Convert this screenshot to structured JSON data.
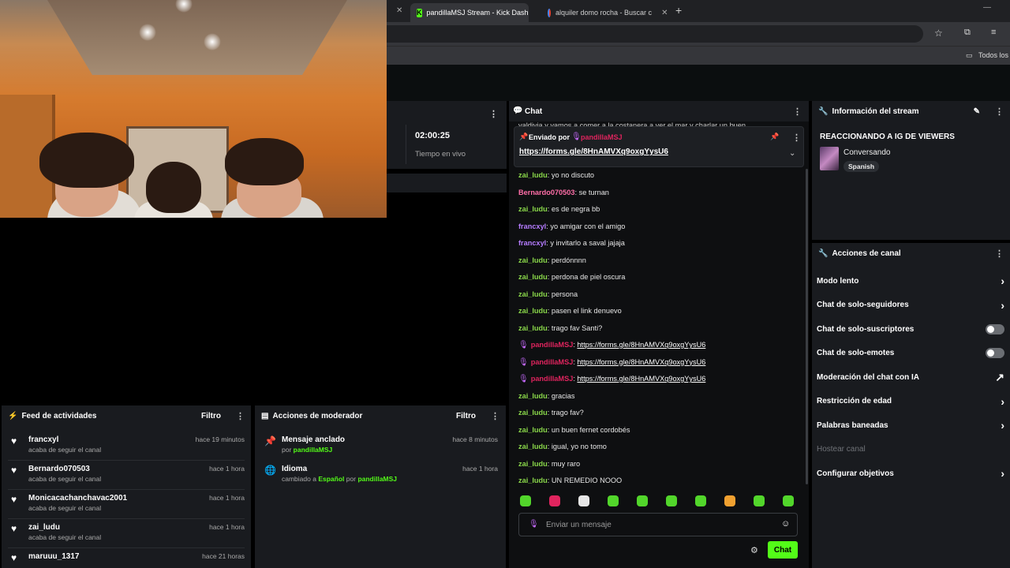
{
  "browser": {
    "tabs": [
      {
        "label": "pandillaMSJ Stream - Kick Dash",
        "active": true
      },
      {
        "label": "alquiler domo rocha - Buscar c",
        "active": false
      }
    ],
    "new_tab": "+",
    "bookmarks_label": "Todos los m"
  },
  "stats": {
    "duration": "02:00:25",
    "duration_label": "Tiempo en vivo"
  },
  "chat": {
    "title": "Chat",
    "cut_message": "valdivia y vamos a comer a la costanera a ver el mar y charlar un buen",
    "pinned": {
      "sent_by_label": "Enviado por",
      "sender": "pandillaMSJ",
      "link": "https://forms.gle/8HnAMVXq9oxgYysU6"
    },
    "messages": [
      {
        "user": "zai_ludu",
        "text": "yo no discuto",
        "color": "#8ad84a"
      },
      {
        "user": "Bernardo070503",
        "text": "se turnan",
        "color": "#ff6ea8"
      },
      {
        "user": "zai_ludu",
        "text": "es de negra bb",
        "color": "#8ad84a"
      },
      {
        "user": "francxyl",
        "text": "yo amigar con el amigo",
        "color": "#b57cff"
      },
      {
        "user": "francxyl",
        "text": "y invitarlo a saval jajaja",
        "color": "#b57cff"
      },
      {
        "user": "zai_ludu",
        "text": "perdónnnn",
        "color": "#8ad84a"
      },
      {
        "user": "zai_ludu",
        "text": "perdona de piel oscura",
        "color": "#8ad84a"
      },
      {
        "user": "zai_ludu",
        "text": "persona",
        "color": "#8ad84a"
      },
      {
        "user": "zai_ludu",
        "text": "pasen el link denuevo",
        "color": "#8ad84a"
      },
      {
        "user": "zai_ludu",
        "text": "trago fav Santi?",
        "color": "#8ad84a"
      },
      {
        "user": "pandillaMSJ",
        "text": "https://forms.gle/8HnAMVXq9oxgYysU6",
        "color": "#e0245e",
        "link": true
      },
      {
        "user": "pandillaMSJ",
        "text": "https://forms.gle/8HnAMVXq9oxgYysU6",
        "color": "#e0245e",
        "link": true
      },
      {
        "user": "pandillaMSJ",
        "text": "https://forms.gle/8HnAMVXq9oxgYysU6",
        "color": "#e0245e",
        "link": true
      },
      {
        "user": "zai_ludu",
        "text": "gracias",
        "color": "#8ad84a"
      },
      {
        "user": "zai_ludu",
        "text": "trago fav?",
        "color": "#8ad84a"
      },
      {
        "user": "zai_ludu",
        "text": "un buen fernet cordobés",
        "color": "#8ad84a"
      },
      {
        "user": "zai_ludu",
        "text": "igual, yo no tomo",
        "color": "#8ad84a"
      },
      {
        "user": "zai_ludu",
        "text": "muy raro",
        "color": "#8ad84a"
      },
      {
        "user": "zai_ludu",
        "text": "UN REMEDIO NOOO",
        "color": "#8ad84a"
      }
    ],
    "input_placeholder": "Enviar un mensaje",
    "send_label": "Chat"
  },
  "info": {
    "title": "Información del stream",
    "stream_title": "REACCIONANDO A IG DE VIEWERS",
    "category": "Conversando",
    "language": "Spanish"
  },
  "actions": {
    "title": "Acciones de canal",
    "items": [
      {
        "label": "Modo lento",
        "control": "chevron"
      },
      {
        "label": "Chat de solo-seguidores",
        "control": "chevron"
      },
      {
        "label": "Chat de solo-suscriptores",
        "control": "toggle"
      },
      {
        "label": "Chat de solo-emotes",
        "control": "toggle"
      },
      {
        "label": "Moderación del chat con IA",
        "control": "external"
      },
      {
        "label": "Restricción de edad",
        "control": "chevron"
      },
      {
        "label": "Palabras baneadas",
        "control": "chevron"
      },
      {
        "label": "Hostear canal",
        "control": "disabled"
      },
      {
        "label": "Configurar objetivos",
        "control": "chevron"
      }
    ]
  },
  "feed": {
    "title": "Feed de actividades",
    "filter_label": "Filtro",
    "items": [
      {
        "user": "francxyl",
        "action": "acaba de seguir el canal",
        "time": "hace 19 minutos"
      },
      {
        "user": "Bernardo070503",
        "action": "acaba de seguir el canal",
        "time": "hace 1 hora"
      },
      {
        "user": "Monicacachanchavac2001",
        "action": "acaba de seguir el canal",
        "time": "hace 1 hora"
      },
      {
        "user": "zai_ludu",
        "action": "acaba de seguir el canal",
        "time": "hace 1 hora"
      },
      {
        "user": "maruuu_1317",
        "action": "",
        "time": "hace 21 horas"
      }
    ]
  },
  "mod": {
    "title": "Acciones de moderador",
    "filter_label": "Filtro",
    "items": [
      {
        "title": "Mensaje anclado",
        "by_label": "por",
        "by": "pandillaMSJ",
        "time": "hace 8 minutos"
      },
      {
        "title": "Idioma",
        "changed_label": "cambiado a",
        "value": "Español",
        "by_label": "por",
        "by": "pandillaMSJ",
        "time": "hace 1 hora"
      }
    ]
  }
}
